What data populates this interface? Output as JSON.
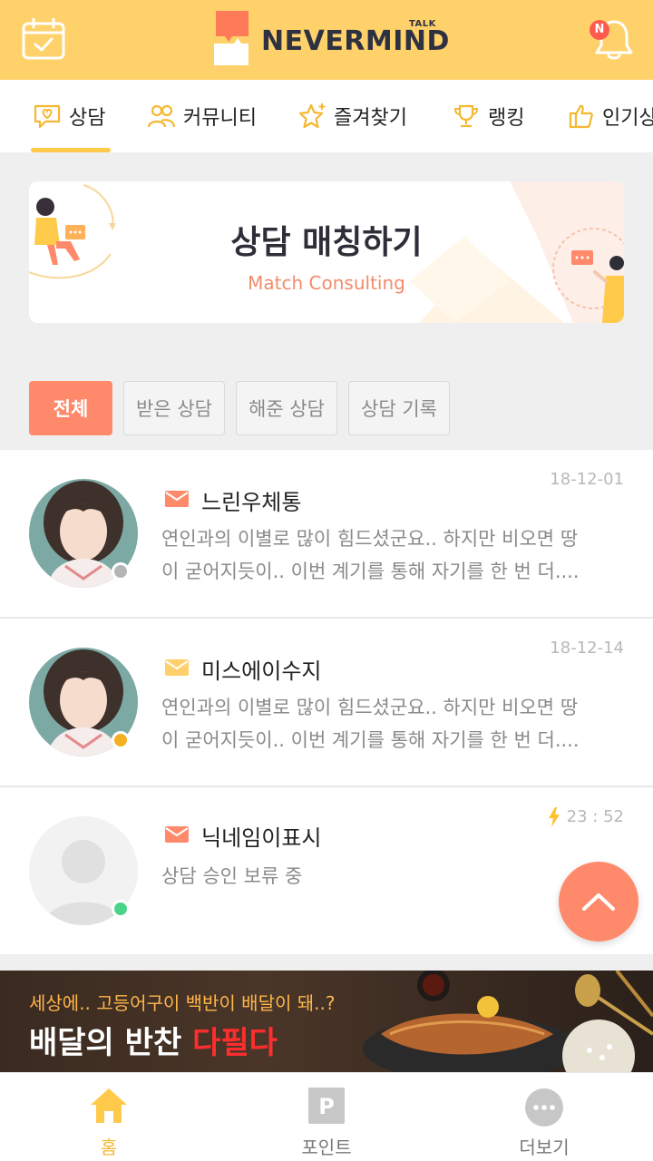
{
  "header": {
    "logo_text": "NEVERMIND",
    "logo_talk": "TALK",
    "notification_badge": "N"
  },
  "tabs": [
    {
      "label": "상담",
      "icon": "heart-chat-icon",
      "active": true
    },
    {
      "label": "커뮤니티",
      "icon": "people-icon",
      "active": false
    },
    {
      "label": "즐겨찾기",
      "icon": "star-icon",
      "active": false
    },
    {
      "label": "랭킹",
      "icon": "trophy-icon",
      "active": false
    },
    {
      "label": "인기상",
      "icon": "thumbs-up-icon",
      "active": false
    }
  ],
  "banner": {
    "title": "상담 매칭하기",
    "subtitle": "Match Consulting"
  },
  "filters": [
    {
      "label": "전체",
      "active": true
    },
    {
      "label": "받은 상담",
      "active": false
    },
    {
      "label": "해준 상담",
      "active": false
    },
    {
      "label": "상담 기록",
      "active": false
    }
  ],
  "messages": [
    {
      "name": "느린우체통",
      "date": "18-12-01",
      "preview_line1": "연인과의 이별로 많이 힘드셨군요.. 하지만 비오면 땅",
      "preview_line2": "이 굳어지듯이.. 이번 계기를 통해 자기를 한 번 더....",
      "mail_color": "#ff8a6b",
      "status_color": "#b5b5b5",
      "has_photo": true
    },
    {
      "name": "미스에이수지",
      "date": "18-12-14",
      "preview_line1": "연인과의 이별로 많이 힘드셨군요.. 하지만 비오면 땅",
      "preview_line2": "이 굳어지듯이.. 이번 계기를 통해 자기를 한 번 더....",
      "mail_color": "#ffd06a",
      "status_color": "#f5b022",
      "has_photo": true
    },
    {
      "name": "닉네임이표시",
      "date": "23 : 52",
      "preview_line1": "상담 승인 보류 중",
      "preview_line2": "",
      "mail_color": "#ff8a6b",
      "status_color": "#4cd38a",
      "has_photo": false
    }
  ],
  "ad": {
    "line1": "세상에.. 고등어구이 백반이 배달이 돼..?",
    "line2_white": "배달의 반찬",
    "line2_red": "다필다"
  },
  "bottom_nav": [
    {
      "label": "홈",
      "icon": "home-icon",
      "active": true
    },
    {
      "label": "포인트",
      "icon": "points-icon",
      "active": false
    },
    {
      "label": "더보기",
      "icon": "more-icon",
      "active": false
    }
  ],
  "colors": {
    "header_bg": "#ffd16a",
    "accent_orange": "#ff8a6b",
    "accent_yellow": "#ffc94a"
  }
}
